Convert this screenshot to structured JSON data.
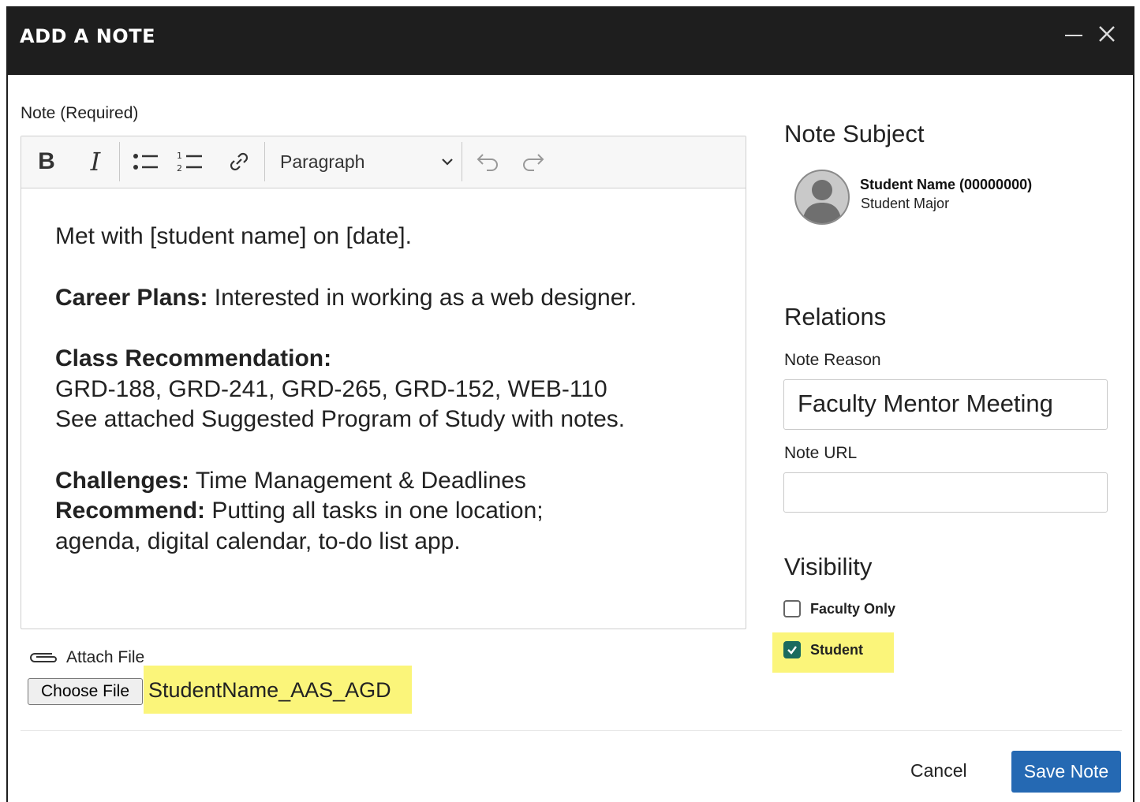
{
  "dialog": {
    "title": "ADD A NOTE"
  },
  "editor": {
    "label": "Note (Required)",
    "toolbar": {
      "bold": "B",
      "italic": "I",
      "block_format": "Paragraph"
    },
    "content": {
      "line1": "Met with [student name] on [date].",
      "career_label": "Career Plans:",
      "career_text": " Interested in working as a web designer.",
      "class_label": "Class Recommendation:",
      "class_list": "GRD-188, GRD-241, GRD-265, GRD-152, WEB-110",
      "class_note": "See attached Suggested Program of Study with notes.",
      "challenges_label": "Challenges:",
      "challenges_text": " Time Management & Deadlines",
      "recommend_label": "Recommend:",
      "recommend_text": " Putting all tasks in one location;",
      "recommend_text2": "agenda, digital calendar, to-do list app."
    }
  },
  "attachment": {
    "label": "Attach File",
    "button_label": "Choose File",
    "file_name": "StudentName_AAS_AGD"
  },
  "subject": {
    "heading": "Note Subject",
    "student_name": "Student Name (00000000)",
    "student_major": "Student Major"
  },
  "relations": {
    "heading": "Relations",
    "reason_label": "Note Reason",
    "reason_value": "Faculty Mentor Meeting",
    "url_label": "Note URL",
    "url_value": ""
  },
  "visibility": {
    "heading": "Visibility",
    "options": [
      {
        "label": "Faculty Only",
        "checked": false
      },
      {
        "label": "Student",
        "checked": true
      }
    ]
  },
  "footer": {
    "cancel_label": "Cancel",
    "save_label": "Save Note"
  },
  "colors": {
    "titlebar": "#1e1e1e",
    "primary_button": "#2569b3",
    "highlight": "#fbf57a",
    "checkbox_checked": "#1b6b5e"
  }
}
